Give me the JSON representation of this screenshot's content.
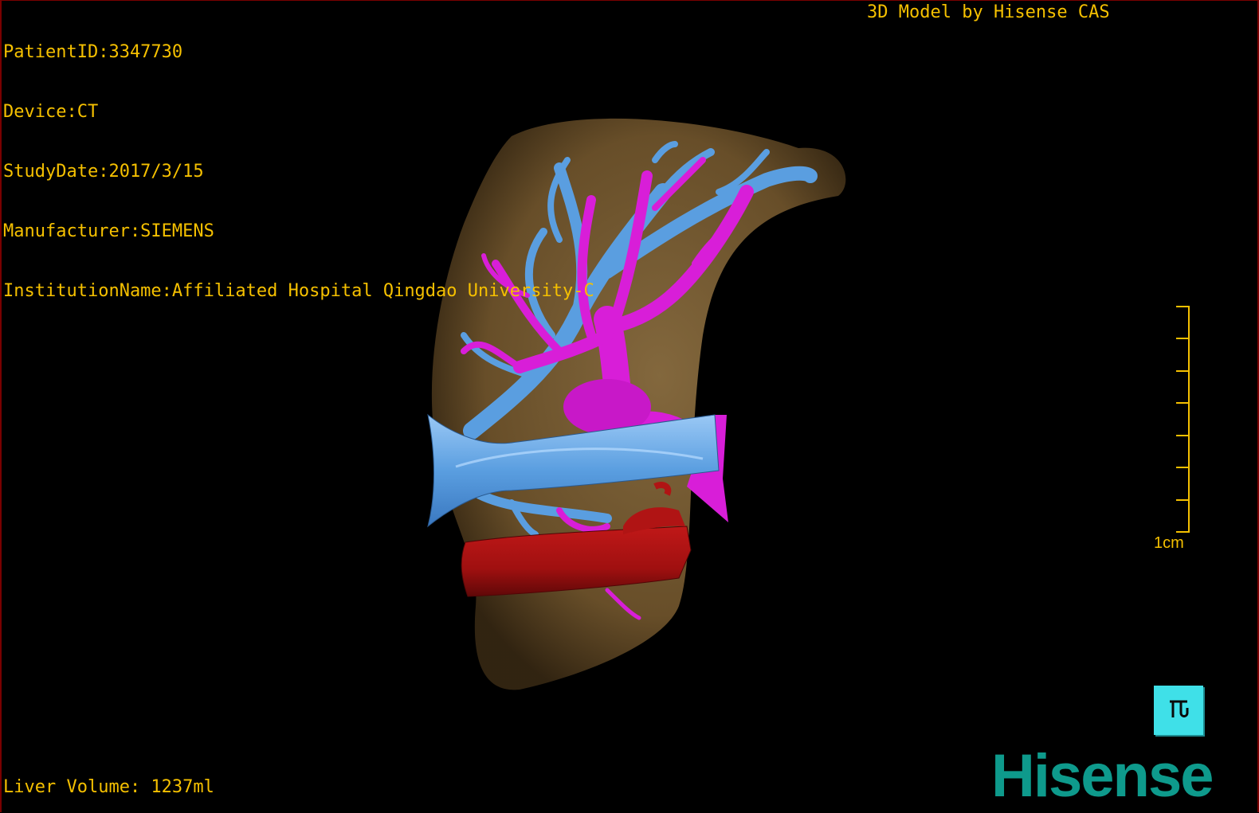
{
  "header": {
    "patient_id": "PatientID:3347730",
    "device": "Device:CT",
    "study_date": "StudyDate:2017/3/15",
    "manufacturer": "Manufacturer:SIEMENS",
    "institution": "InstitutionName:Affiliated Hospital Qingdao University-C"
  },
  "brand": {
    "top_caption": "3D Model by Hisense CAS",
    "logo_text": "Hisense"
  },
  "scale": {
    "label": "1cm"
  },
  "footer": {
    "volume": "Liver Volume: 1237ml"
  },
  "colors": {
    "overlay_text": "#f5c000",
    "liver": "#8a6a3a",
    "portal_vein": "#d81ed8",
    "hepatic_vein": "#5a9ee0",
    "aorta": "#a81010",
    "logo": "#0e9a8c",
    "nav_cube": "#3fe0e8"
  },
  "icons": {
    "nav_cube": "orientation-cube-icon"
  }
}
